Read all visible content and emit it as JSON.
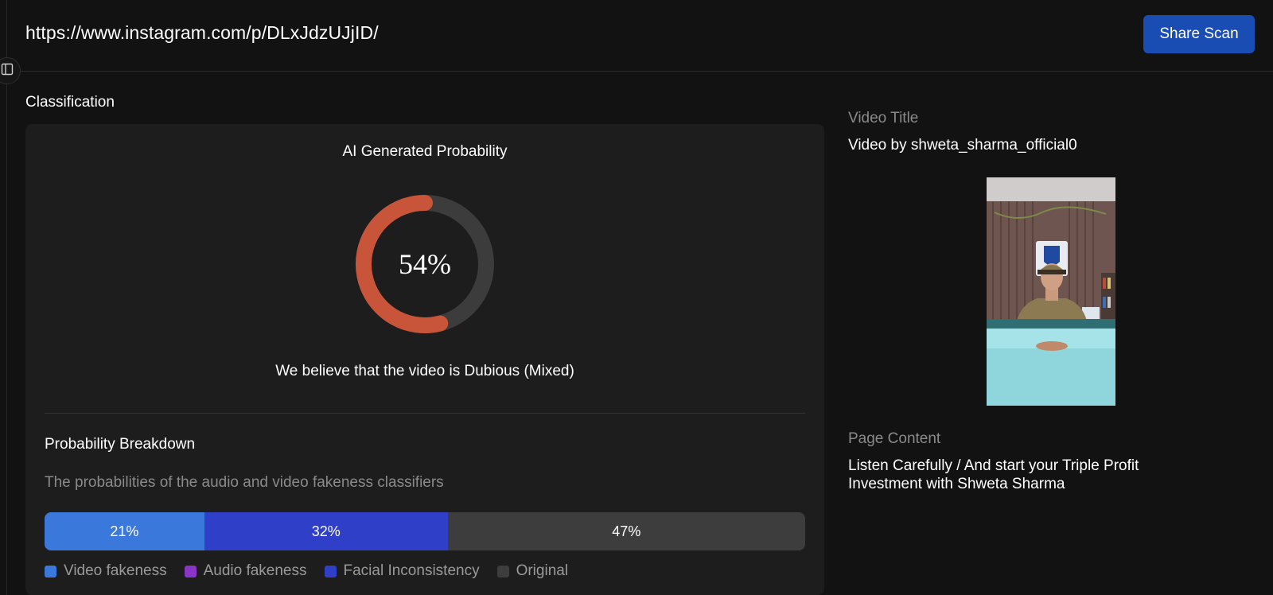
{
  "header": {
    "url": "https://www.instagram.com/p/DLxJdzUJjID/",
    "share_label": "Share Scan"
  },
  "classification": {
    "section_title": "Classification",
    "heading": "AI Generated Probability",
    "probability": 54,
    "probability_label": "54%",
    "verdict": "We believe that the video is Dubious (Mixed)",
    "colors": {
      "ring_fill": "#c8553a",
      "ring_track": "#3c3c3c"
    }
  },
  "breakdown": {
    "title": "Probability Breakdown",
    "subtitle": "The probabilities of the audio and video fakeness classifiers",
    "segments": [
      {
        "value": 21,
        "label": "21%",
        "color": "#3b78dc"
      },
      {
        "value": 32,
        "label": "32%",
        "color": "#2f3fc8"
      },
      {
        "value": 47,
        "label": "47%",
        "color": "#3d3d3d"
      }
    ],
    "legend": [
      {
        "label": "Video fakeness",
        "color": "#3b78dc"
      },
      {
        "label": "Audio fakeness",
        "color": "#8a35c7"
      },
      {
        "label": "Facial Inconsistency",
        "color": "#2f3fc8"
      },
      {
        "label": "Original",
        "color": "#3d3d3d"
      }
    ]
  },
  "info": {
    "video_title_label": "Video Title",
    "video_title": "Video by shweta_sharma_official0",
    "page_content_label": "Page Content",
    "page_content": "Listen Carefully / And start your Triple Profit Investment with Shweta Sharma"
  }
}
